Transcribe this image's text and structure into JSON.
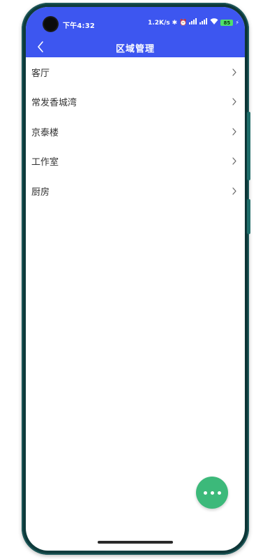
{
  "status_bar": {
    "time": "下午4:32",
    "speed": "1.2K/s",
    "battery": "85"
  },
  "header": {
    "title": "区域管理"
  },
  "areas": [
    {
      "label": "客厅"
    },
    {
      "label": "常发香城湾"
    },
    {
      "label": "京泰楼"
    },
    {
      "label": "工作室"
    },
    {
      "label": "厨房"
    }
  ],
  "colors": {
    "header_bg": "#3d56f0",
    "fab_bg": "#3cb97a",
    "frame": "#0e3a3b"
  },
  "icons": {
    "back": "chevron-left-icon",
    "row": "chevron-right-icon",
    "fab": "more-horizontal-icon"
  }
}
